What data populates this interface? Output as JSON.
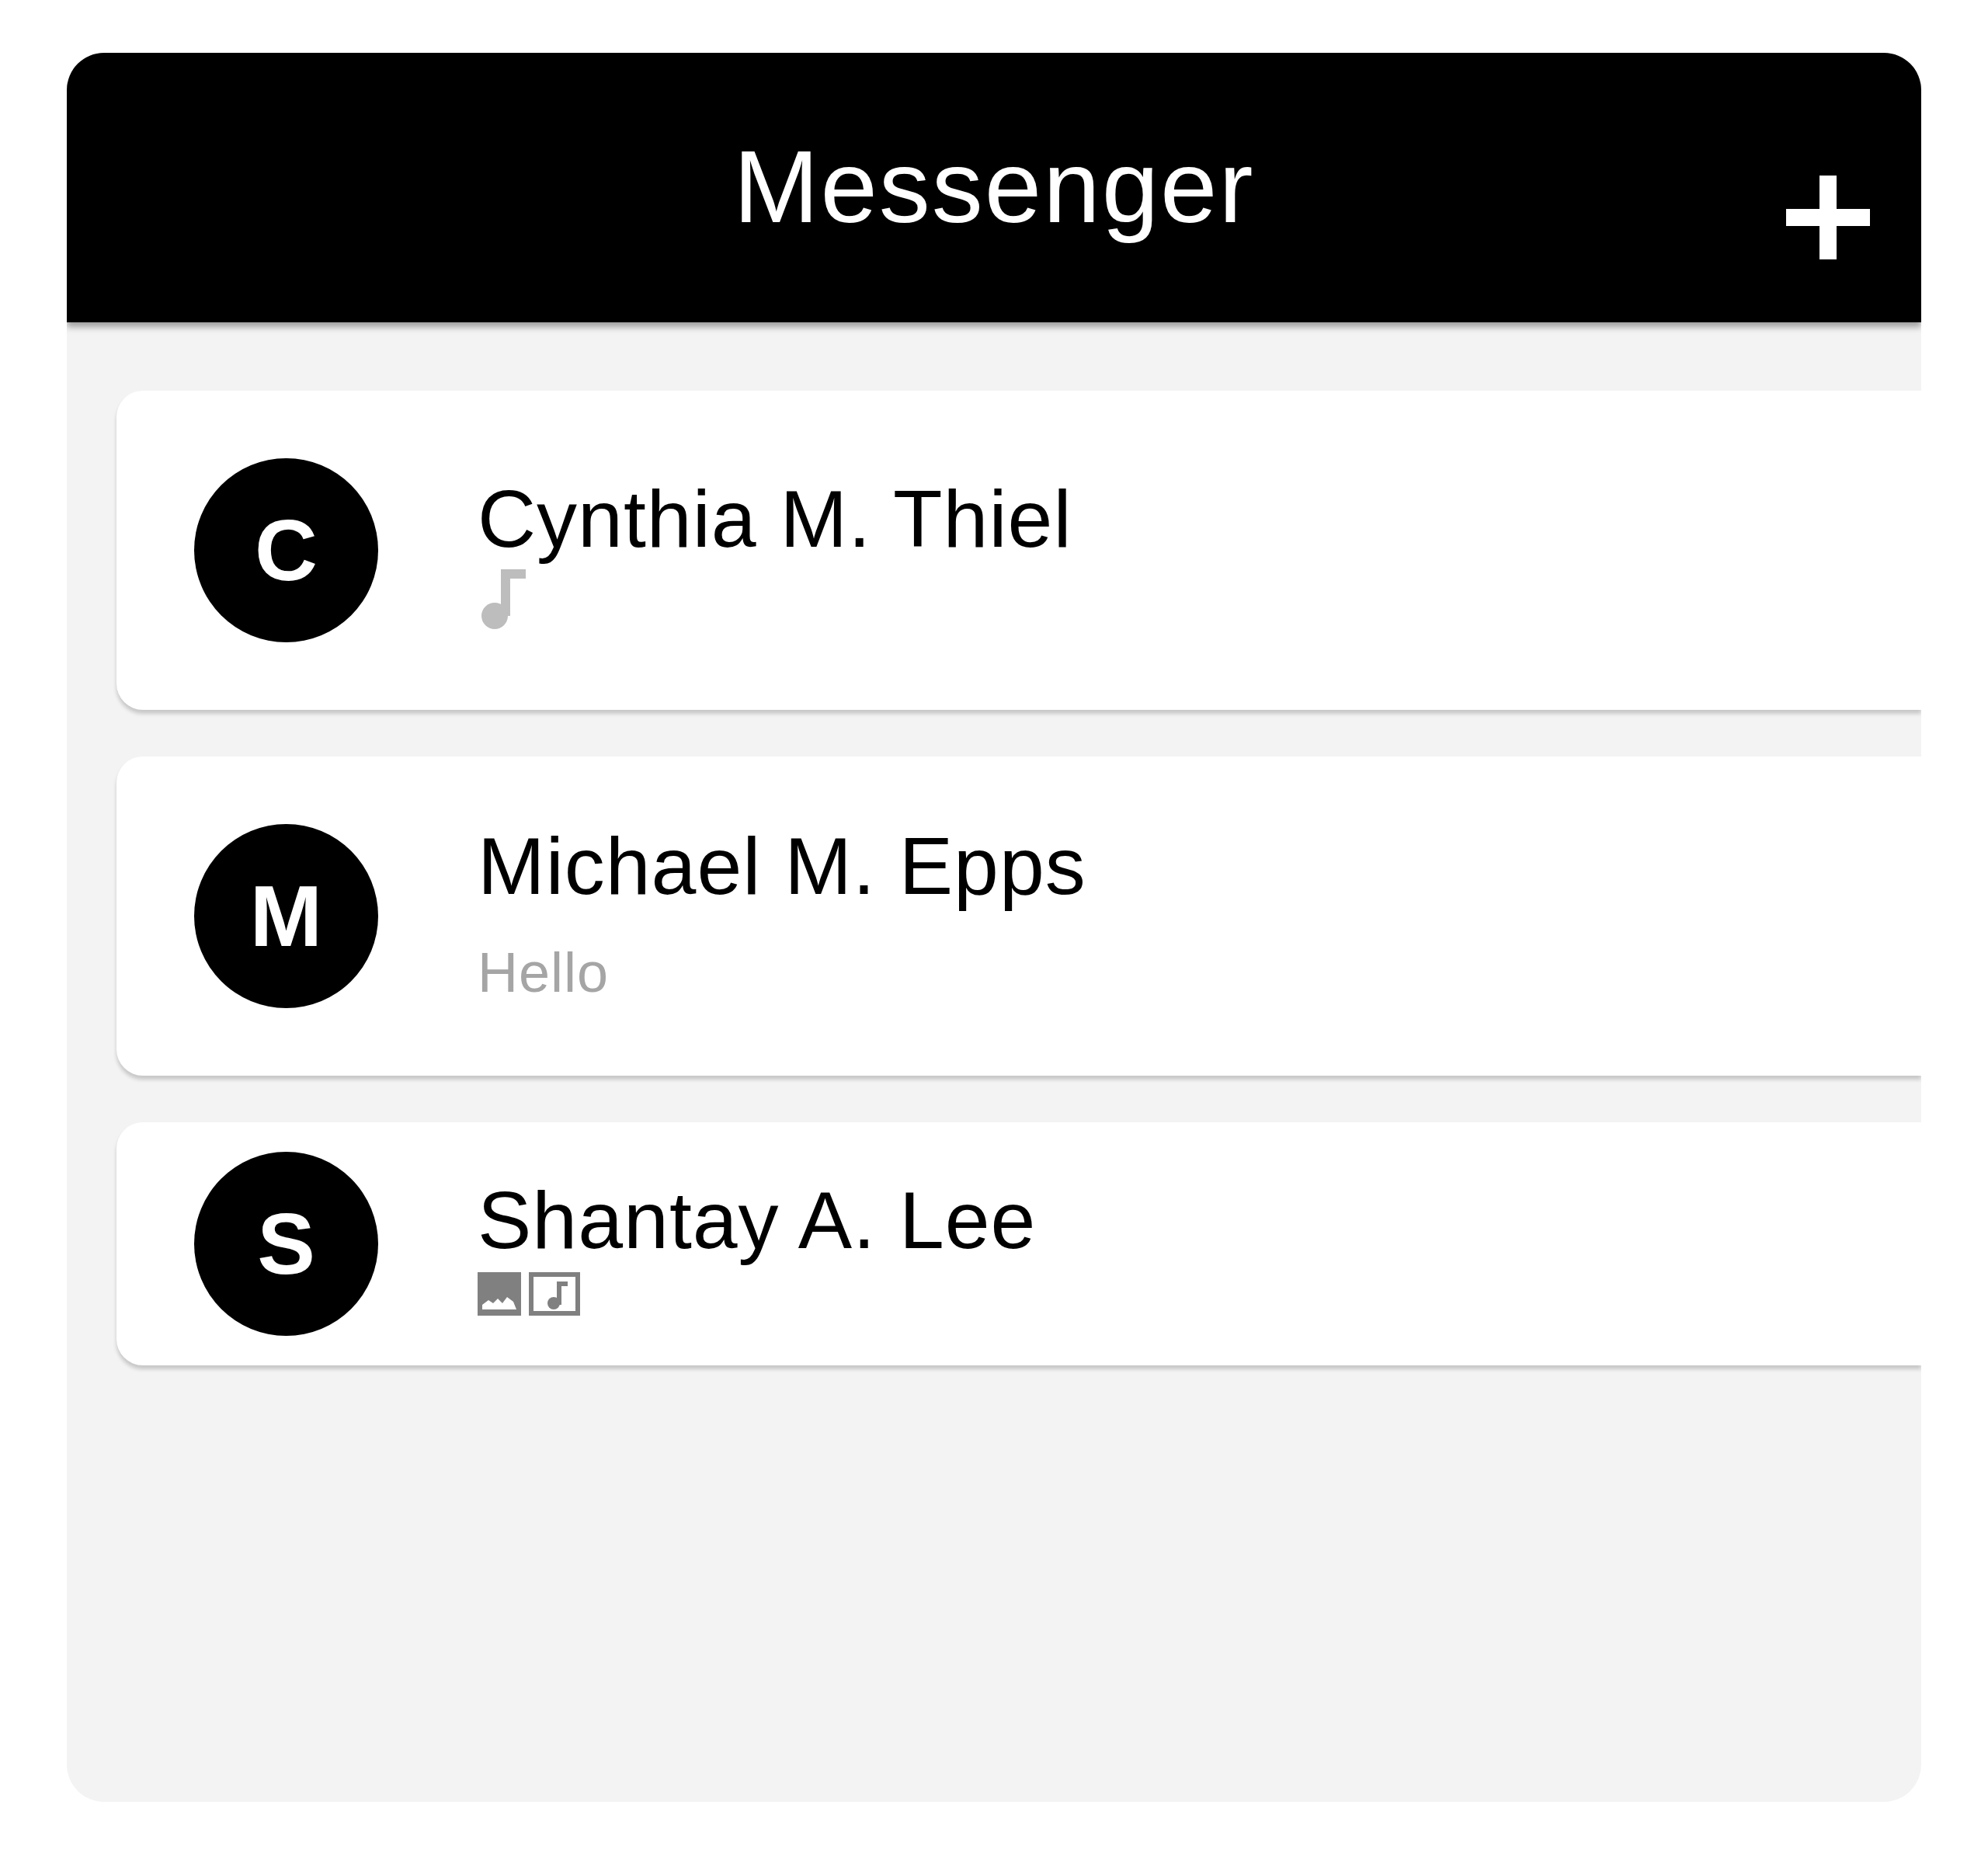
{
  "header": {
    "title": "Messenger"
  },
  "conversations": [
    {
      "avatar_letter": "C",
      "name": "Cynthia M. Thiel",
      "preview": {
        "kind": "audio"
      }
    },
    {
      "avatar_letter": "M",
      "name": "Michael M. Epps",
      "preview": {
        "kind": "text",
        "text": "Hello"
      }
    },
    {
      "avatar_letter": "S",
      "name": "Shantay A. Lee",
      "preview": {
        "kind": "attachments",
        "items": [
          {
            "kind": "image"
          },
          {
            "kind": "audio"
          }
        ]
      }
    }
  ]
}
